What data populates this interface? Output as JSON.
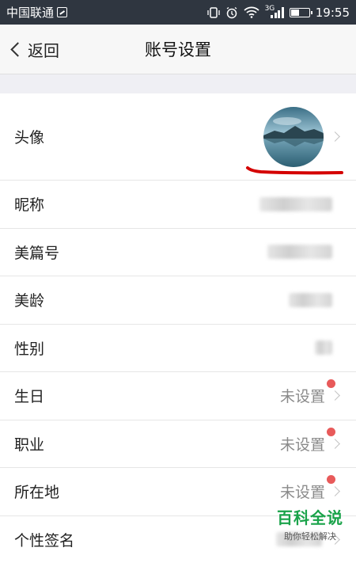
{
  "status_bar": {
    "carrier": "中国联通",
    "network": "3G",
    "time": "19:55",
    "battery_level": 0.45
  },
  "nav": {
    "back_label": "返回",
    "title": "账号设置"
  },
  "rows": [
    {
      "label": "头像"
    },
    {
      "label": "昵称"
    },
    {
      "label": "美篇号"
    },
    {
      "label": "美龄"
    },
    {
      "label": "性别"
    },
    {
      "label": "生日",
      "value": "未设置"
    },
    {
      "label": "职业",
      "value": "未设置"
    },
    {
      "label": "所在地",
      "value": "未设置"
    },
    {
      "label": "个性签名"
    }
  ],
  "watermark": {
    "title": "百科全说",
    "subtitle": "助你轻松解决"
  },
  "colors": {
    "accent_dot": "#e85a5a",
    "annotation": "#d40000",
    "watermark_green": "#1aa34a"
  }
}
